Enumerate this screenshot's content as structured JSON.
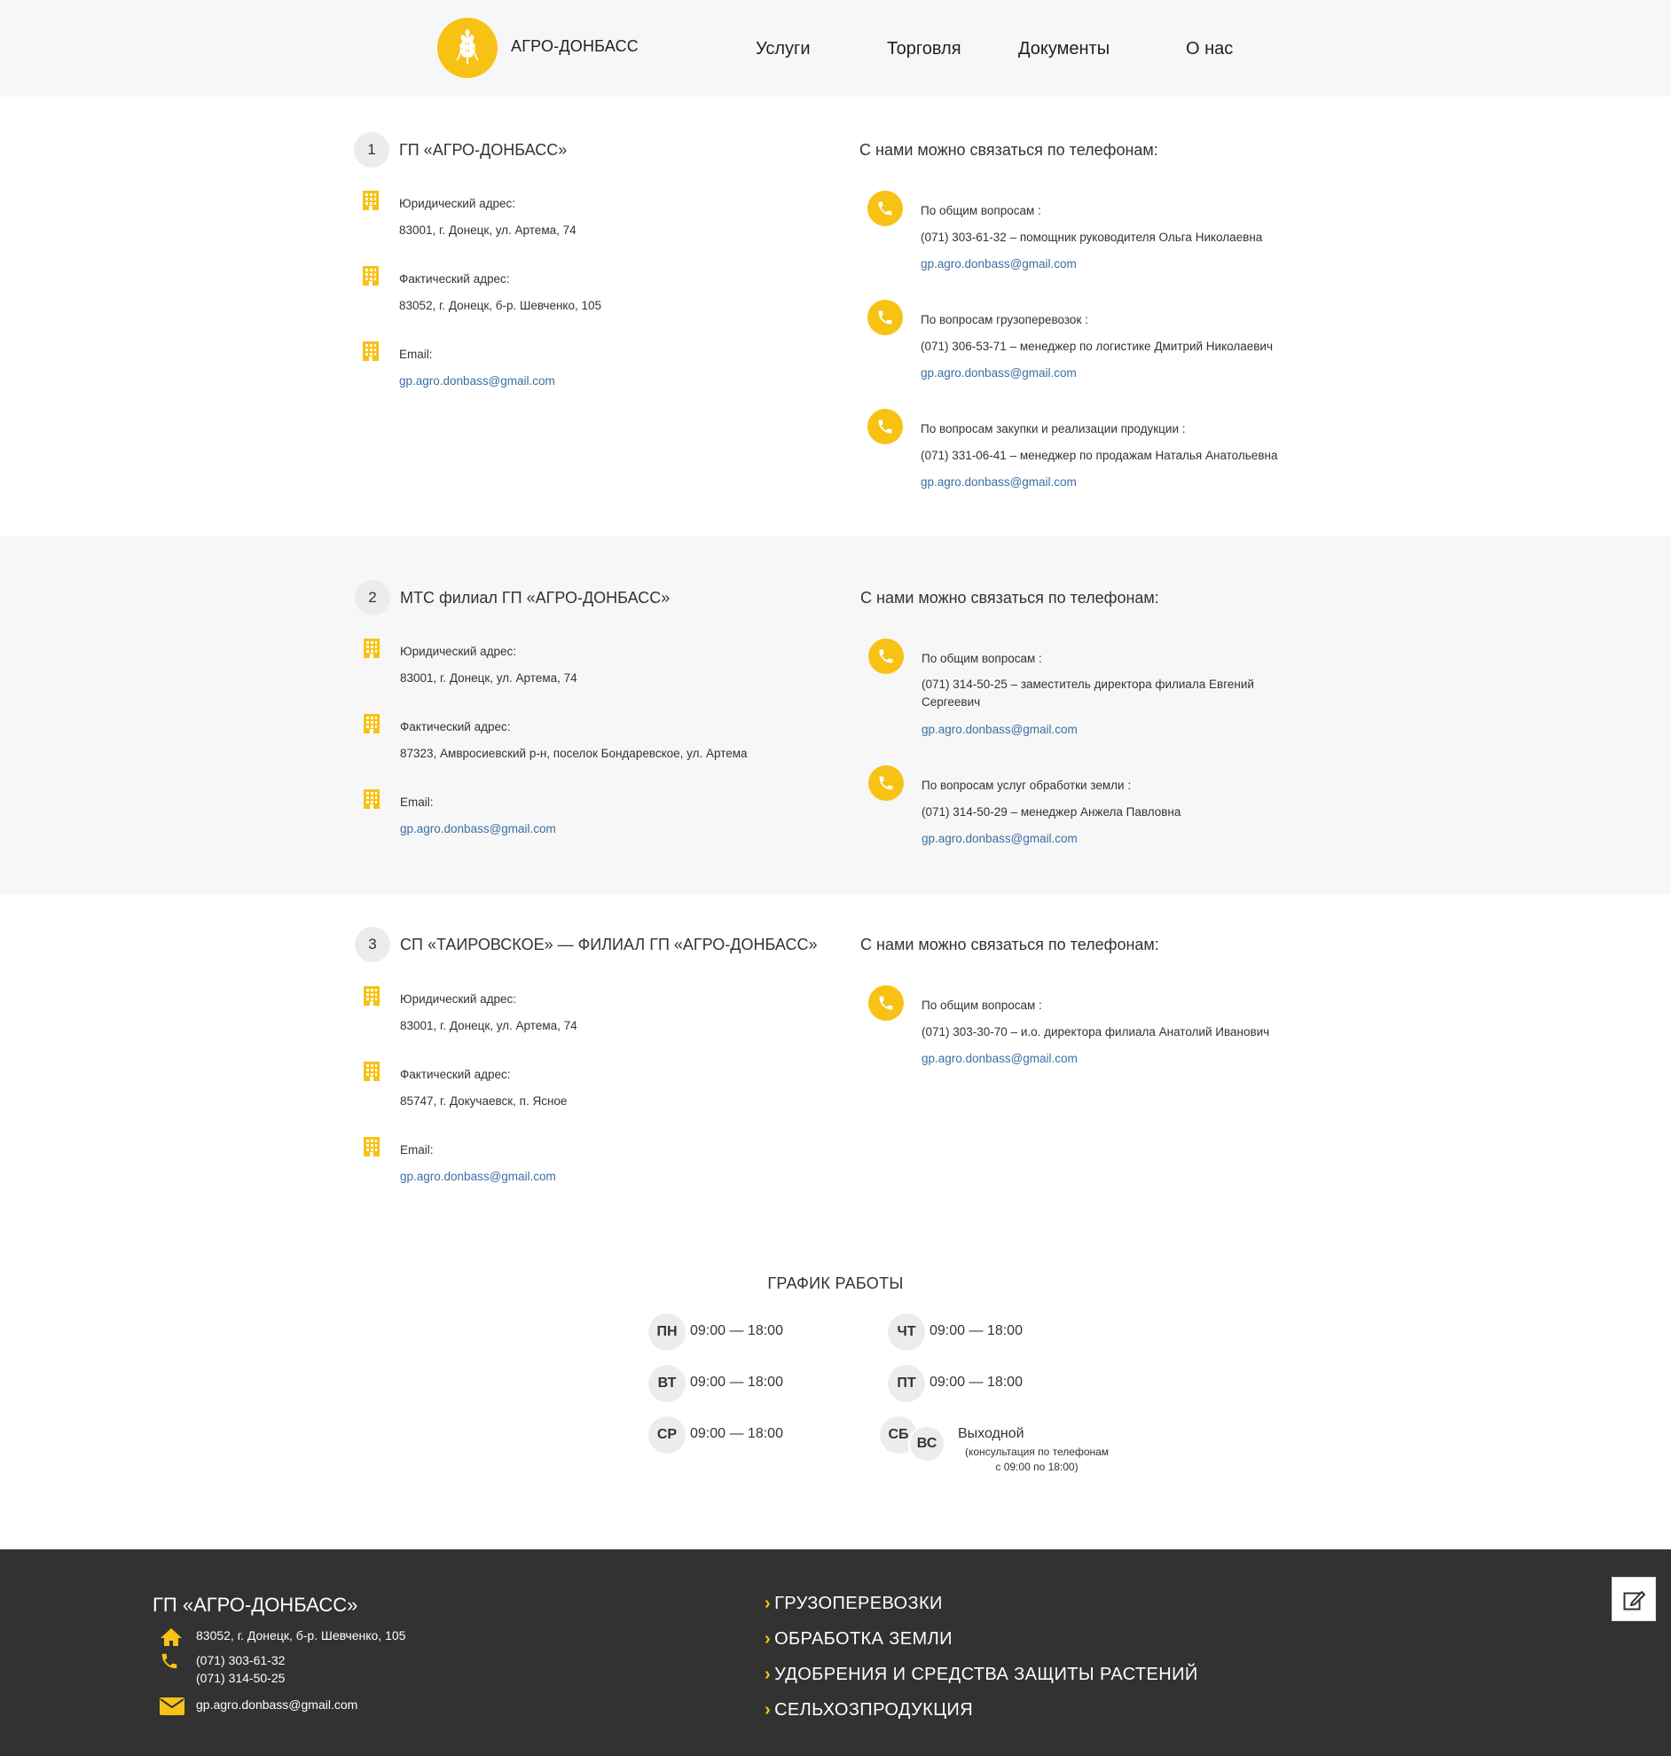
{
  "header": {
    "brand": "АГРО-ДОНБАСС",
    "nav": [
      "Услуги",
      "Торговля",
      "Документы",
      "О нас"
    ]
  },
  "contacts_title": "С нами можно связаться по телефонам:",
  "orgs": [
    {
      "num": "1",
      "title": "ГП «АГРО-ДОНБАСС»",
      "legal_label": "Юридический адрес:",
      "legal": "83001, г. Донецк, ул. Артема, 74",
      "actual_label": "Фактический адрес:",
      "actual": "83052, г. Донецк, б-р. Шевченко, 105",
      "email_label": "Email:",
      "email": "gp.agro.donbass@gmail.com",
      "phones": [
        {
          "topic": "По общим вопросам :",
          "line": "(071) 303-61-32 – помощник руководителя Ольга Николаевна",
          "email": "gp.agro.donbass@gmail.com"
        },
        {
          "topic": "По вопросам грузоперевозок :",
          "line": "(071) 306-53-71 – менеджер по логистике Дмитрий Николаевич",
          "email": "gp.agro.donbass@gmail.com"
        },
        {
          "topic": "По вопросам закупки и реализации продукции :",
          "line": "(071) 331-06-41 – менеджер по продажам Наталья Анатольевна",
          "email": "gp.agro.donbass@gmail.com"
        }
      ]
    },
    {
      "num": "2",
      "title": "МТС филиал ГП «АГРО-ДОНБАСС»",
      "legal_label": "Юридический адрес:",
      "legal": "83001, г. Донецк, ул. Артема, 74",
      "actual_label": "Фактический адрес:",
      "actual": "87323, Амвросиевский р-н, поселок Бондаревское, ул. Артема",
      "email_label": "Email:",
      "email": "gp.agro.donbass@gmail.com",
      "phones": [
        {
          "topic": "По общим вопросам :",
          "line": "(071) 314-50-25 – заместитель директора филиала Евгений Сергеевич",
          "email": "gp.agro.donbass@gmail.com"
        },
        {
          "topic": "По вопросам услуг обработки земли :",
          "line": "(071) 314-50-29 – менеджер Анжела Павловна",
          "email": "gp.agro.donbass@gmail.com"
        }
      ]
    },
    {
      "num": "3",
      "title": "СП «ТАИРОВСКОЕ» — ФИЛИАЛ ГП «АГРО-ДОНБАСС»",
      "legal_label": "Юридический адрес:",
      "legal": "83001, г. Донецк, ул. Артема, 74",
      "actual_label": "Фактический адрес:",
      "actual": "85747, г. Докучаевск, п. Ясное",
      "email_label": "Email:",
      "email": "gp.agro.donbass@gmail.com",
      "phones": [
        {
          "topic": "По общим вопросам :",
          "line": "(071) 303-30-70 – и.о. директора филиала Анатолий Иванович",
          "email": "gp.agro.donbass@gmail.com"
        }
      ]
    }
  ],
  "schedule": {
    "title": "ГРАФИК РАБОТЫ",
    "days": [
      {
        "day": "ПН",
        "time": "09:00 — 18:00"
      },
      {
        "day": "ВТ",
        "time": "09:00 — 18:00"
      },
      {
        "day": "СР",
        "time": "09:00 — 18:00"
      },
      {
        "day": "ЧТ",
        "time": "09:00 — 18:00"
      },
      {
        "day": "ПТ",
        "time": "09:00 — 18:00"
      }
    ],
    "weekend": {
      "sat": "СБ",
      "sun": "ВС",
      "status": "Выходной",
      "note1": "(консультация по телефонам",
      "note2": "с 09:00 по 18:00)"
    }
  },
  "footer": {
    "title": "ГП «АГРО-ДОНБАСС»",
    "address": "83052, г. Донецк, б-р. Шевченко, 105",
    "phone1": "(071) 303-61-32",
    "phone2": "(071) 314-50-25",
    "email": "gp.agro.donbass@gmail.com",
    "links": [
      "ГРУЗОПЕРЕВОЗКИ",
      "ОБРАБОТКА ЗЕМЛИ",
      "УДОБРЕНИЯ И СРЕДСТВА ЗАЩИТЫ РАСТЕНИЙ",
      "СЕЛЬХОЗПРОДУКЦИЯ"
    ]
  },
  "colors": {
    "accent": "#f8c215",
    "link": "#3a6ea5",
    "footer_bg": "#323232"
  }
}
